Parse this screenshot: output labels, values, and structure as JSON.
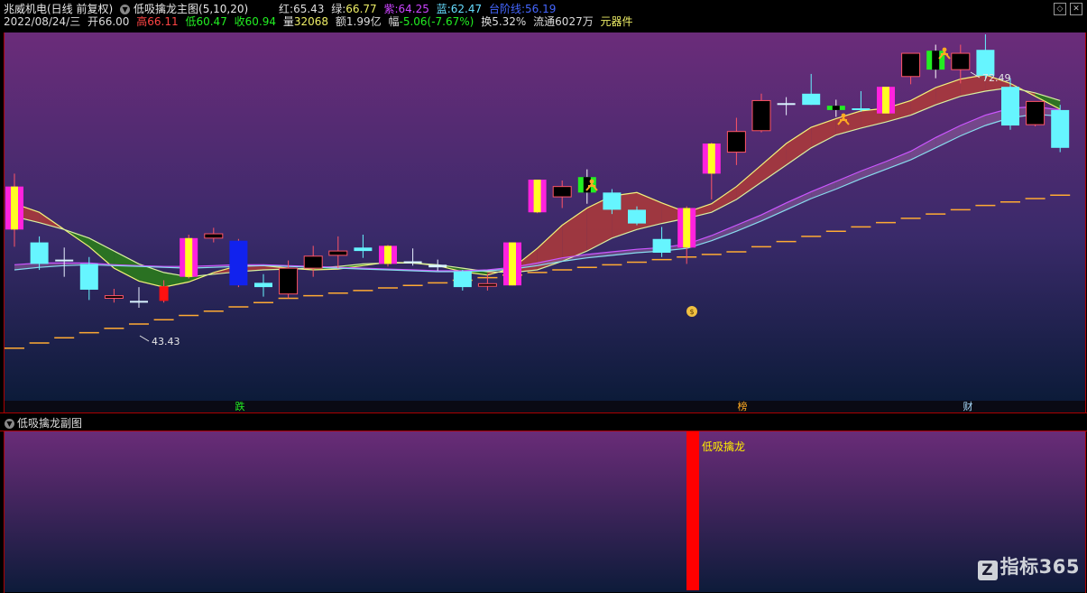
{
  "header": {
    "stock_name": "兆威机电(日线 前复权)",
    "indicator_name": "低吸擒龙主图(5,10,20)",
    "red_label": "红:",
    "red_value": "65.43",
    "green_label": "绿:",
    "green_value": "66.77",
    "purple_label": "紫:",
    "purple_value": "64.25",
    "blue_label": "蓝:",
    "blue_value": "62.47",
    "support_label": "台阶线:",
    "support_value": "56.19",
    "date": "2022/08/24/三",
    "open_label": "开",
    "open_value": "66.00",
    "high_label": "高",
    "high_value": "66.11",
    "low_label": "低",
    "low_value": "60.47",
    "close_label": "收",
    "close_value": "60.94",
    "volume_label": "量",
    "volume_value": "32068",
    "amount_label": "额",
    "amount_value": "1.99亿",
    "change_label": "幅",
    "change_value": "-5.06(-7.67%)",
    "turnover_label": "换",
    "turnover_value": "5.32%",
    "float_label": "流通",
    "float_value": "6027万",
    "sector": "元器件"
  },
  "subchart": {
    "title": "低吸擒龙副图",
    "signal_label": "低吸擒龙"
  },
  "brand": {
    "name": "指标365",
    "logo_letter": "Z"
  },
  "colors": {
    "bg_top": "#6b2c79",
    "bg_bottom": "#0b1d3a",
    "up_candle": "#ff5566",
    "down_candle": "#66f5ff",
    "red": "#ff4444",
    "green": "#22ee22",
    "purple": "#cc44ff",
    "blue": "#3366ff",
    "support": "#ffaa33",
    "signal_bar": "#ff0000",
    "signal_text": "#ffee00"
  },
  "chart_data": {
    "type": "candlestick",
    "ylim": [
      40,
      77
    ],
    "candles": [
      {
        "o": 64.5,
        "h": 66.0,
        "l": 57.5,
        "c": 59.5,
        "style": "stripe"
      },
      {
        "o": 58.0,
        "h": 58.7,
        "l": 54.8,
        "c": 55.5,
        "style": "down"
      },
      {
        "o": 56.0,
        "h": 57.4,
        "l": 54.0,
        "c": 55.8,
        "style": "cross"
      },
      {
        "o": 55.5,
        "h": 56.3,
        "l": 51.3,
        "c": 52.5,
        "style": "down"
      },
      {
        "o": 51.5,
        "h": 52.6,
        "l": 51.0,
        "c": 51.8,
        "style": "up"
      },
      {
        "o": 51.2,
        "h": 52.8,
        "l": 50.4,
        "c": 51.0,
        "style": "cross"
      },
      {
        "o": 51.2,
        "h": 53.6,
        "l": 51.0,
        "c": 52.9,
        "style": "solidred"
      },
      {
        "o": 54.0,
        "h": 58.9,
        "l": 53.8,
        "c": 58.5,
        "style": "stripe"
      },
      {
        "o": 58.5,
        "h": 59.7,
        "l": 58.0,
        "c": 59.0,
        "style": "up"
      },
      {
        "o": 58.2,
        "h": 58.4,
        "l": 52.8,
        "c": 53.0,
        "style": "blue"
      },
      {
        "o": 53.3,
        "h": 54.3,
        "l": 51.7,
        "c": 52.8,
        "style": "down"
      },
      {
        "o": 52.0,
        "h": 55.9,
        "l": 51.5,
        "c": 55.0,
        "style": "up"
      },
      {
        "o": 55.0,
        "h": 57.6,
        "l": 54.0,
        "c": 56.4,
        "style": "up"
      },
      {
        "o": 56.5,
        "h": 58.7,
        "l": 55.0,
        "c": 57.0,
        "style": "up"
      },
      {
        "o": 57.4,
        "h": 58.9,
        "l": 56.2,
        "c": 57.0,
        "style": "down"
      },
      {
        "o": 57.6,
        "h": 57.7,
        "l": 55.2,
        "c": 55.5,
        "style": "stripe"
      },
      {
        "o": 55.8,
        "h": 57.3,
        "l": 55.3,
        "c": 55.7,
        "style": "cross"
      },
      {
        "o": 55.4,
        "h": 56.0,
        "l": 54.7,
        "c": 55.1,
        "style": "cross"
      },
      {
        "o": 54.6,
        "h": 54.8,
        "l": 52.4,
        "c": 52.8,
        "style": "down"
      },
      {
        "o": 52.9,
        "h": 54.3,
        "l": 52.4,
        "c": 53.2,
        "style": "up"
      },
      {
        "o": 53.0,
        "h": 58.0,
        "l": 53.0,
        "c": 58.0,
        "style": "stripe"
      },
      {
        "o": 61.5,
        "h": 65.3,
        "l": 61.4,
        "c": 65.3,
        "style": "stripe"
      },
      {
        "o": 63.3,
        "h": 65.2,
        "l": 62.0,
        "c": 64.5,
        "style": "up"
      },
      {
        "o": 63.8,
        "h": 66.5,
        "l": 62.5,
        "c": 65.6,
        "style": "green"
      },
      {
        "o": 63.8,
        "h": 64.2,
        "l": 61.3,
        "c": 61.8,
        "style": "down"
      },
      {
        "o": 61.8,
        "h": 62.2,
        "l": 60.0,
        "c": 60.2,
        "style": "down"
      },
      {
        "o": 58.4,
        "h": 59.8,
        "l": 56.3,
        "c": 56.8,
        "style": "down"
      },
      {
        "o": 57.4,
        "h": 62.2,
        "l": 55.5,
        "c": 62.0,
        "style": "stripe"
      },
      {
        "o": 66.0,
        "h": 69.6,
        "l": 63.0,
        "c": 69.5,
        "style": "stripe"
      },
      {
        "o": 68.5,
        "h": 72.5,
        "l": 67.0,
        "c": 70.9,
        "style": "up"
      },
      {
        "o": 71.0,
        "h": 75.3,
        "l": 70.8,
        "c": 74.5,
        "style": "up"
      },
      {
        "o": 74.0,
        "h": 74.9,
        "l": 72.8,
        "c": 74.2,
        "style": "cross"
      },
      {
        "o": 75.3,
        "h": 77.6,
        "l": 74.0,
        "c": 74.0,
        "style": "down"
      },
      {
        "o": 73.4,
        "h": 74.6,
        "l": 72.6,
        "c": 73.9,
        "style": "green"
      },
      {
        "o": 73.6,
        "h": 75.6,
        "l": 73.2,
        "c": 73.4,
        "style": "down"
      },
      {
        "o": 73.0,
        "h": 76.1,
        "l": 73.0,
        "c": 76.1,
        "style": "stripe"
      },
      {
        "o": 77.3,
        "h": 78.5,
        "l": 76.4,
        "c": 80.0,
        "style": "up"
      },
      {
        "o": 80.3,
        "h": 81.0,
        "l": 77.1,
        "c": 78.1,
        "style": "green"
      },
      {
        "o": 78.1,
        "h": 81.0,
        "l": 76.5,
        "c": 80.0,
        "style": "up"
      },
      {
        "o": 80.4,
        "h": 82.2,
        "l": 77.1,
        "c": 77.4,
        "style": "down"
      },
      {
        "o": 76.1,
        "h": 77.1,
        "l": 71.1,
        "c": 71.6,
        "style": "down"
      },
      {
        "o": 71.7,
        "h": 73.0,
        "l": 71.5,
        "c": 74.4,
        "style": "up"
      },
      {
        "o": 73.4,
        "h": 74.0,
        "l": 68.5,
        "c": 69.0,
        "style": "down"
      }
    ],
    "ma_lines": {
      "yellow": [
        62.5,
        61.5,
        59.5,
        57.5,
        55.0,
        53.5,
        52.8,
        53.4,
        54.5,
        55.3,
        55.3,
        55.0,
        54.8,
        54.9,
        55.3,
        55.7,
        55.6,
        55.3,
        54.6,
        54.2,
        55.0,
        57.3,
        60.0,
        62.0,
        63.4,
        63.8,
        62.6,
        61.5,
        62.5,
        64.5,
        67.0,
        69.5,
        71.4,
        72.4,
        73.3,
        73.6,
        74.5,
        76.0,
        77.0,
        77.5,
        76.5,
        75.0,
        73.5
      ],
      "green": [
        61.0,
        60.3,
        59.5,
        58.5,
        57.0,
        55.5,
        54.5,
        54.0,
        54.3,
        54.6,
        54.8,
        54.9,
        55.0,
        55.2,
        55.5,
        55.6,
        55.6,
        55.4,
        55.0,
        54.6,
        54.5,
        54.8,
        55.8,
        57.0,
        58.5,
        59.5,
        60.2,
        60.8,
        61.5,
        63.0,
        65.0,
        67.0,
        69.0,
        70.5,
        71.3,
        72.0,
        72.8,
        74.0,
        75.0,
        75.6,
        76.0,
        75.4,
        74.5
      ],
      "purple": [
        55.4,
        55.6,
        55.6,
        55.6,
        55.4,
        55.3,
        55.2,
        55.2,
        55.3,
        55.4,
        55.4,
        55.3,
        55.2,
        55.1,
        55.0,
        54.9,
        54.8,
        54.7,
        54.7,
        54.8,
        55.1,
        55.6,
        56.2,
        56.6,
        56.9,
        57.2,
        57.4,
        57.8,
        58.8,
        60.0,
        61.2,
        62.6,
        63.9,
        65.1,
        66.3,
        67.4,
        68.6,
        70.2,
        71.6,
        72.8,
        73.6,
        73.8,
        73.4
      ],
      "blue": [
        54.8,
        55.1,
        55.3,
        55.4,
        55.3,
        55.2,
        55.1,
        55.0,
        55.1,
        55.2,
        55.3,
        55.2,
        55.1,
        55.0,
        54.9,
        54.8,
        54.7,
        54.6,
        54.6,
        54.7,
        54.9,
        55.3,
        55.8,
        56.2,
        56.5,
        56.8,
        57.0,
        57.3,
        58.2,
        59.3,
        60.5,
        61.8,
        63.1,
        64.2,
        65.4,
        66.5,
        67.6,
        69.0,
        70.4,
        71.6,
        72.5,
        72.9,
        72.7
      ]
    },
    "support_line": [
      45.7,
      46.3,
      46.9,
      47.5,
      48.0,
      48.5,
      49.0,
      49.5,
      50.0,
      50.5,
      51.0,
      51.5,
      51.8,
      52.1,
      52.4,
      52.7,
      53.0,
      53.3,
      53.6,
      53.9,
      54.2,
      54.5,
      54.8,
      55.1,
      55.4,
      55.7,
      56.0,
      56.3,
      56.6,
      56.9,
      57.5,
      58.1,
      58.7,
      59.3,
      59.8,
      60.3,
      60.8,
      61.3,
      61.8,
      62.3,
      62.7,
      63.1,
      63.5
    ],
    "annotations": {
      "low_price": "43.43",
      "high_price": "72.49",
      "bottom_marks": [
        "跌",
        "榜",
        "财"
      ]
    },
    "subchart_signal_index": 27
  }
}
